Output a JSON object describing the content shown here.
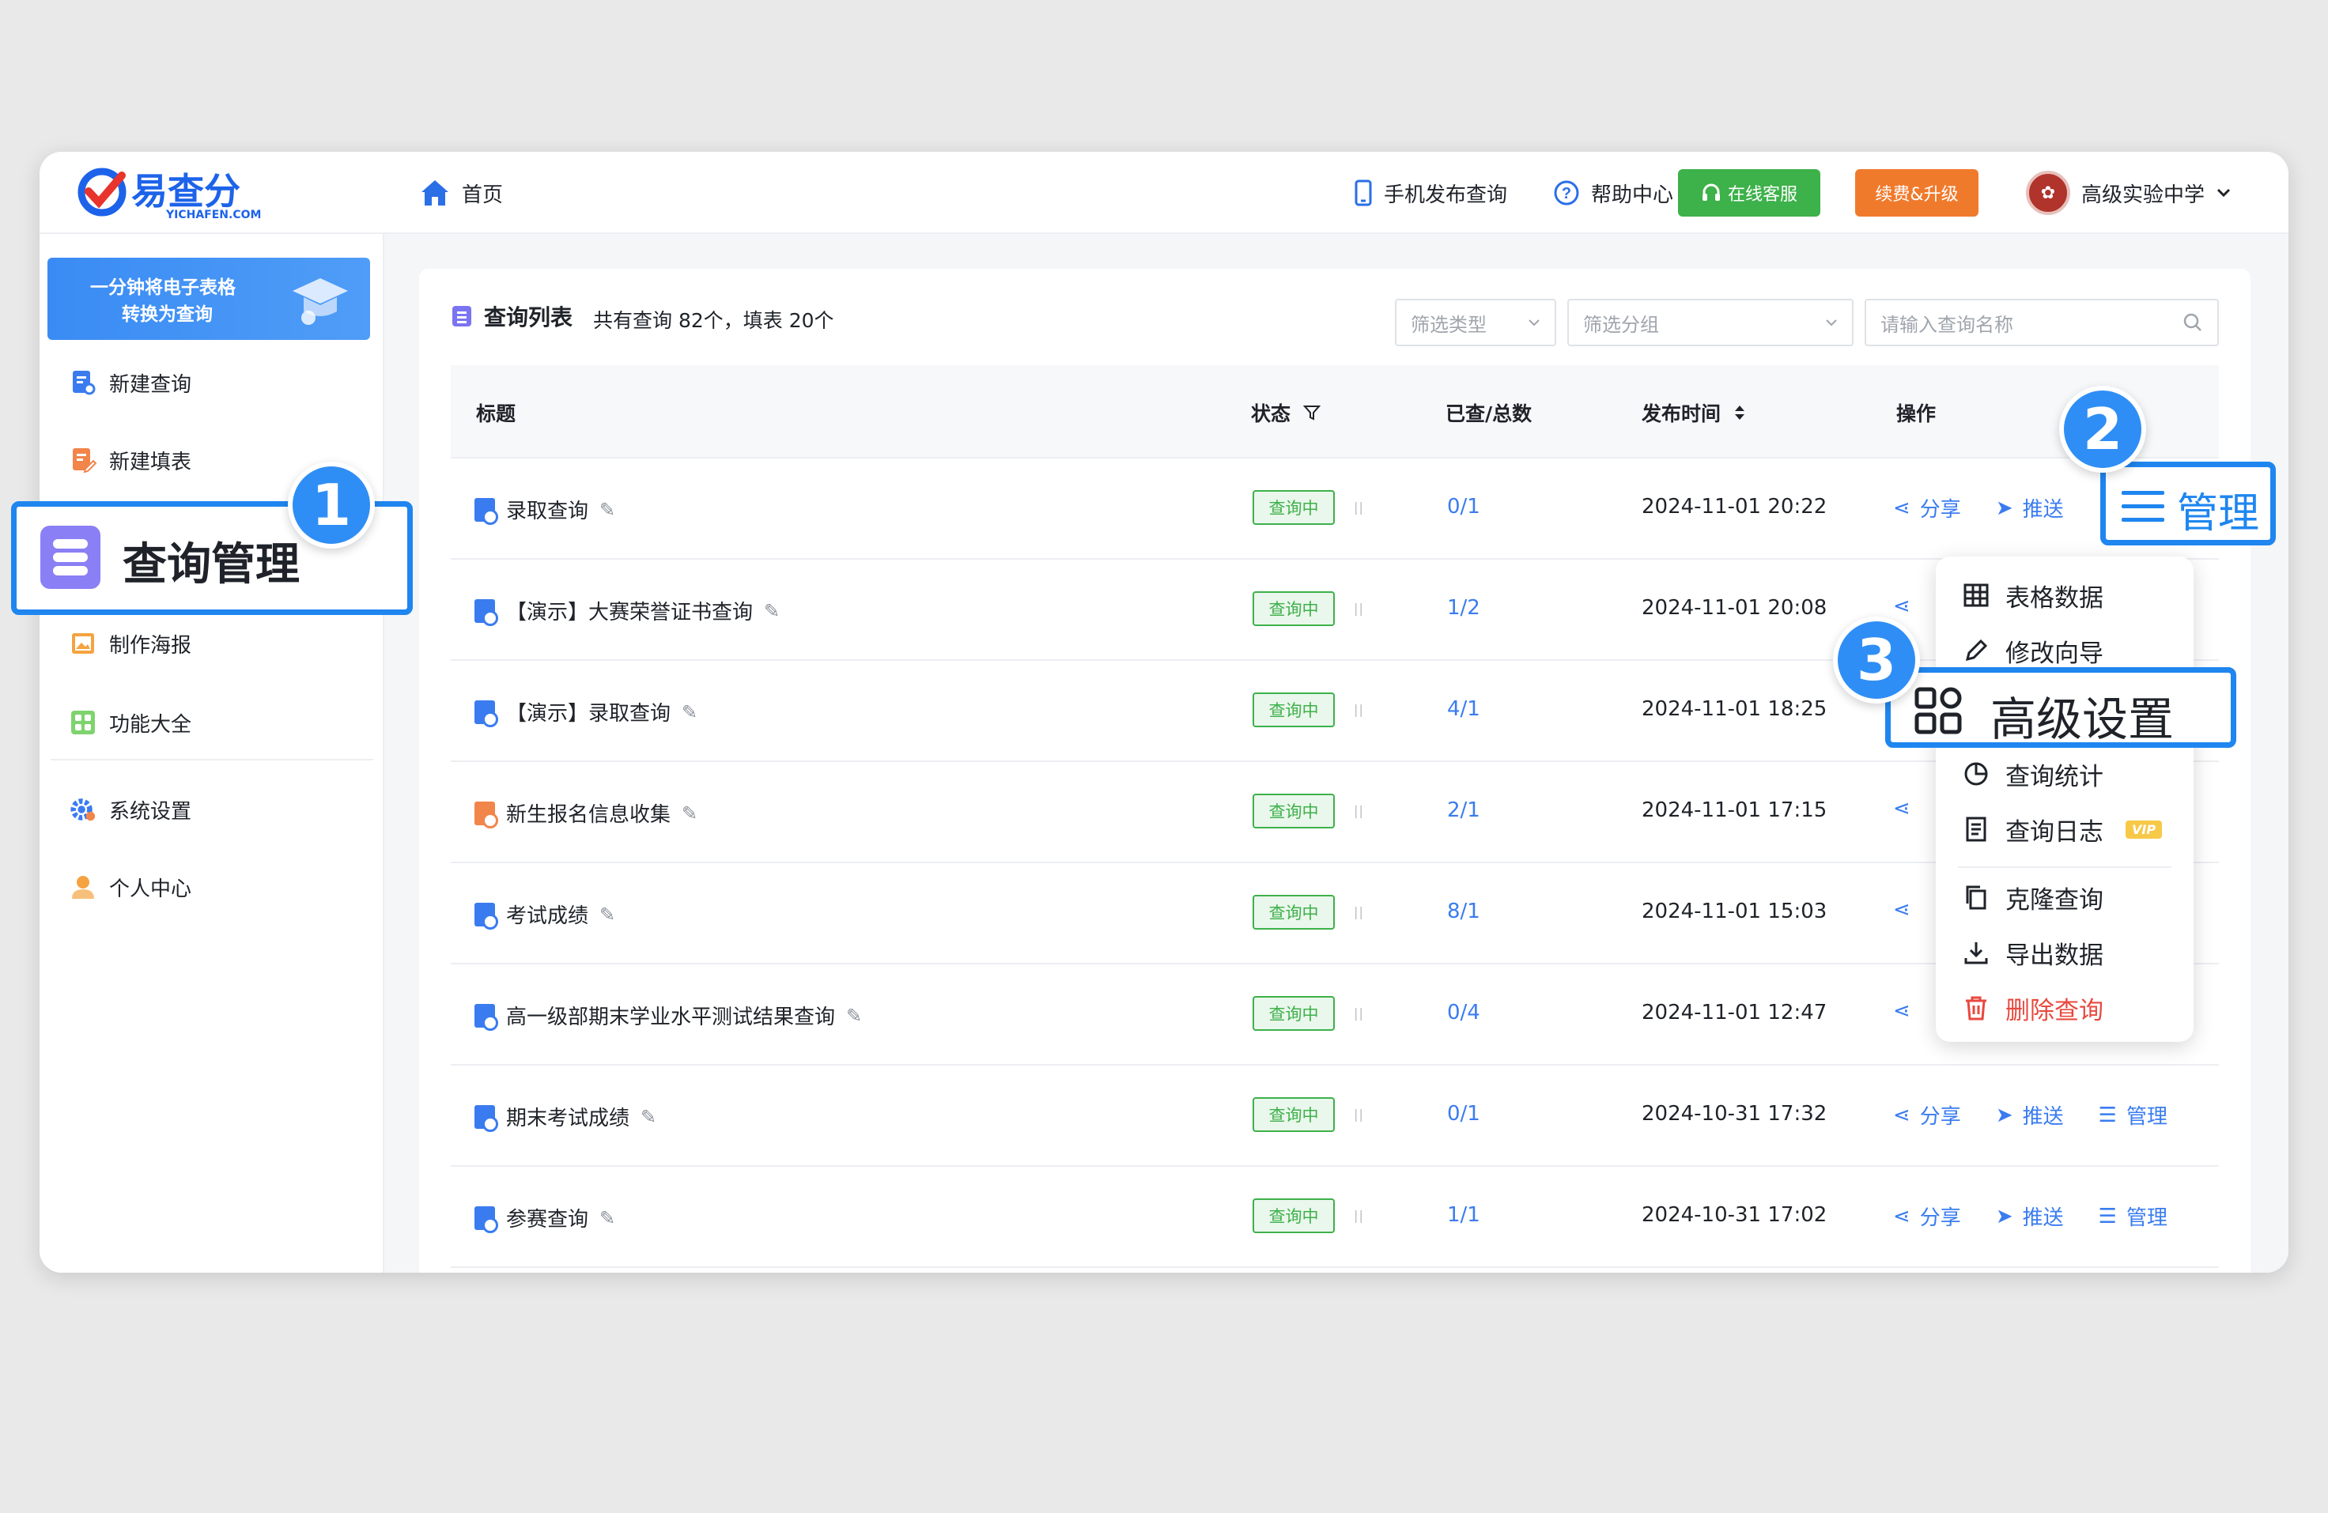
{
  "header": {
    "logo_text": "易查分",
    "logo_sub": "YICHAFEN.COM",
    "home": "首页",
    "mobile": "手机发布查询",
    "help": "帮助中心",
    "service": "在线客服",
    "renew": "续费&升级",
    "school": "高级实验中学"
  },
  "sidebar": {
    "promo_line1": "一分钟将电子表格",
    "promo_line2": "转换为查询",
    "items": [
      {
        "label": "新建查询"
      },
      {
        "label": "新建填表"
      },
      {
        "label": "查询管理"
      },
      {
        "label": "制作海报"
      },
      {
        "label": "功能大全"
      },
      {
        "label": "系统设置"
      },
      {
        "label": "个人中心"
      }
    ]
  },
  "main": {
    "title": "查询列表",
    "count": "共有查询 82个，填表 20个",
    "filter_type": "筛选类型",
    "filter_group": "筛选分组",
    "search_placeholder": "请输入查询名称",
    "columns": {
      "title": "标题",
      "status": "状态",
      "ratio": "已查/总数",
      "time": "发布时间",
      "ops": "操作"
    },
    "rows": [
      {
        "title": "录取查询",
        "status": "查询中",
        "ratio": "0/1",
        "time": "2024-11-01 20:22"
      },
      {
        "title": "【演示】大赛荣誉证书查询",
        "status": "查询中",
        "ratio": "1/2",
        "time": "2024-11-01 20:08"
      },
      {
        "title": "【演示】录取查询",
        "status": "查询中",
        "ratio": "4/1",
        "time": "2024-11-01 18:25"
      },
      {
        "title": "新生报名信息收集",
        "status": "查询中",
        "ratio": "2/1",
        "time": "2024-11-01 17:15"
      },
      {
        "title": "考试成绩",
        "status": "查询中",
        "ratio": "8/1",
        "time": "2024-11-01 15:03"
      },
      {
        "title": "高一级部期末学业水平测试结果查询",
        "status": "查询中",
        "ratio": "0/4",
        "time": "2024-11-01 12:47"
      },
      {
        "title": "期末考试成绩",
        "status": "查询中",
        "ratio": "0/1",
        "time": "2024-10-31 17:32"
      },
      {
        "title": "参赛查询",
        "status": "查询中",
        "ratio": "1/1",
        "time": "2024-10-31 17:02"
      }
    ],
    "ops": {
      "share": "分享",
      "push": "推送",
      "manage": "管理"
    }
  },
  "dropdown": {
    "items": [
      {
        "label": "表格数据"
      },
      {
        "label": "修改向导"
      },
      {
        "label": "高级设置"
      },
      {
        "label": "查询统计"
      },
      {
        "label": "查询日志"
      },
      {
        "label": "克隆查询"
      },
      {
        "label": "导出数据"
      },
      {
        "label": "删除查询"
      }
    ],
    "vip": "VIP"
  },
  "callouts": {
    "step1": "1",
    "step2": "2",
    "step3": "3",
    "step1_label": "查询管理",
    "step2_label": "管理",
    "step3_label": "高级设置"
  },
  "colors": {
    "primary": "#1f86f0",
    "link": "#3a7cf0",
    "green": "#3db14a",
    "orange": "#f07a2c",
    "danger": "#e8493f"
  }
}
